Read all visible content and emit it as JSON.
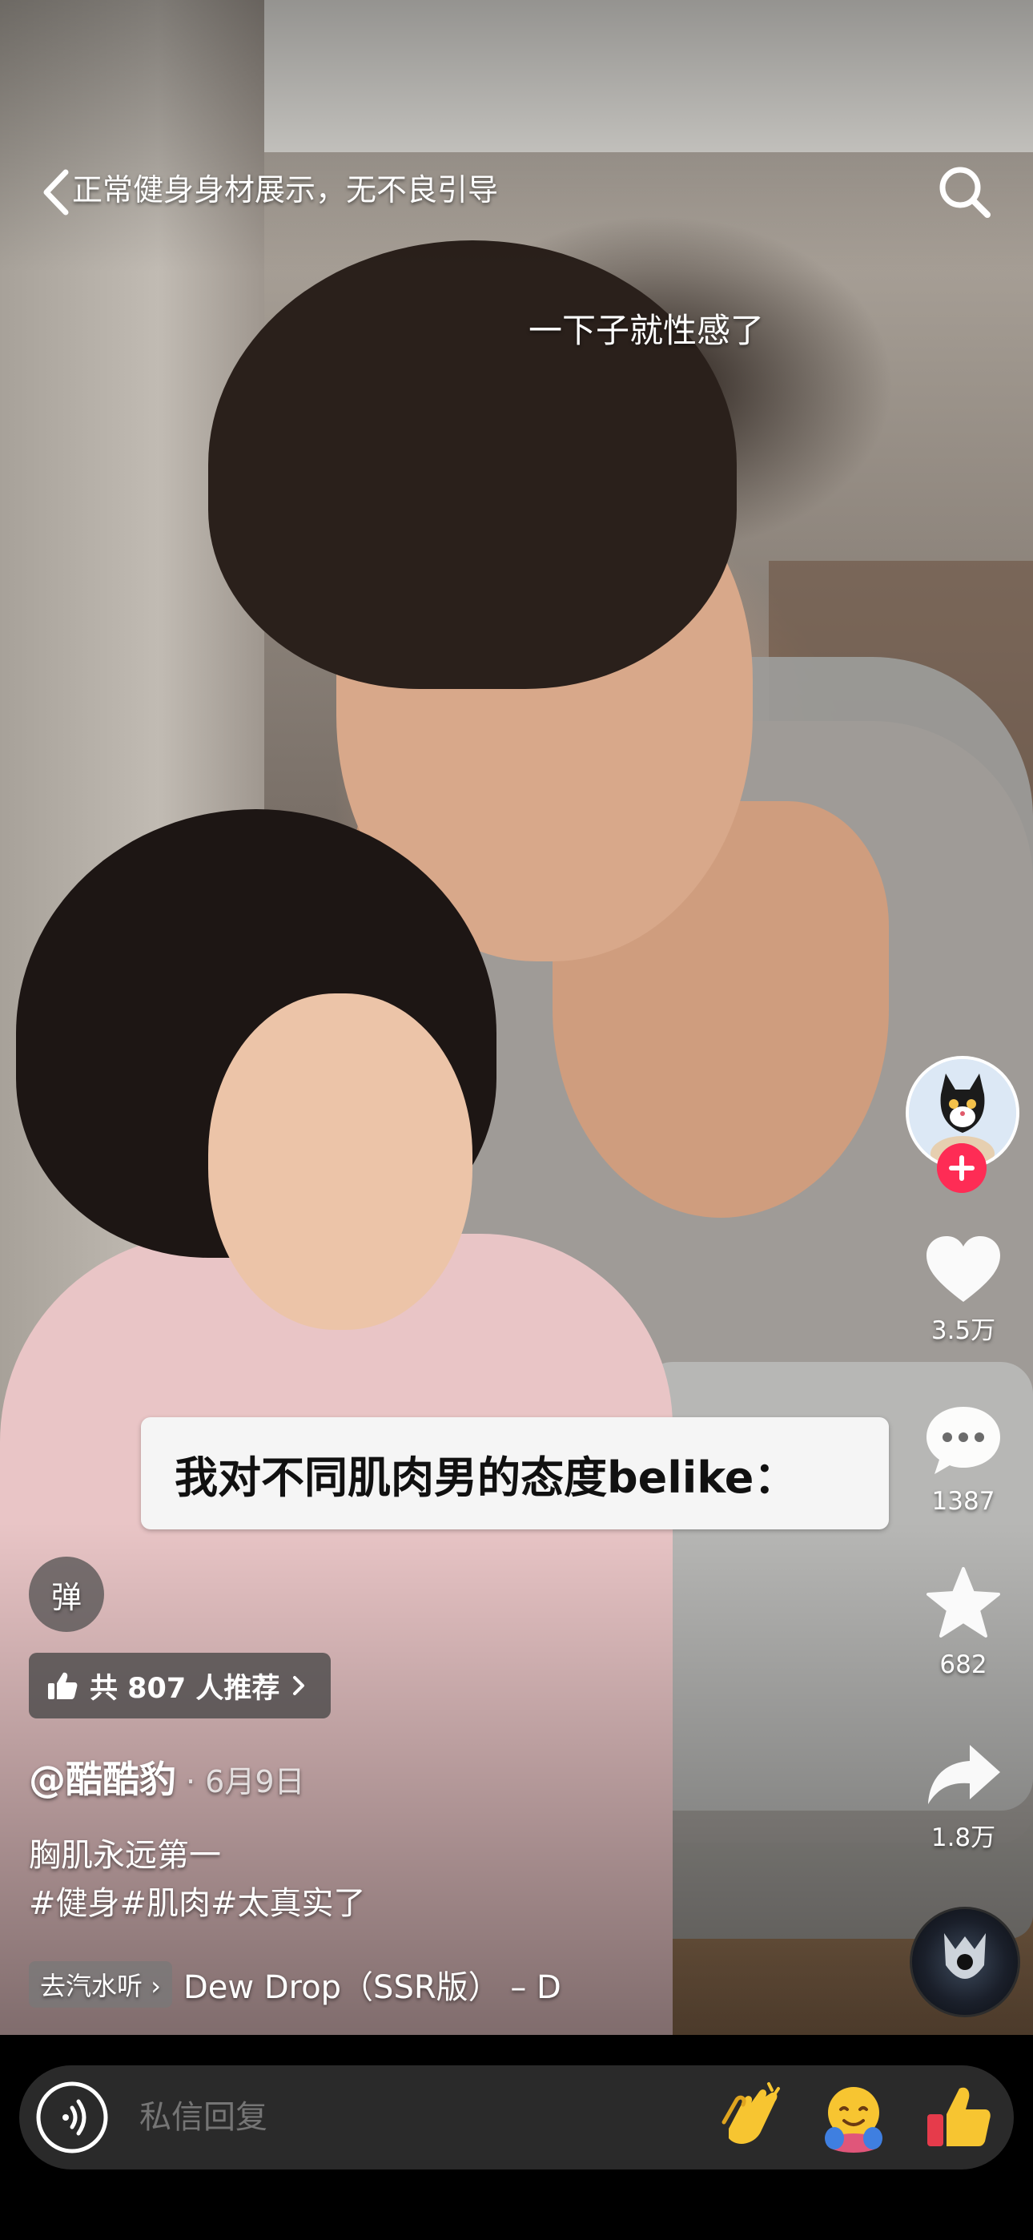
{
  "header": {
    "title": "正常健身身材展示，无不良引导",
    "back_icon": "chevron-left-icon",
    "search_icon": "search-icon"
  },
  "video": {
    "subtitle": "一下子就性感了",
    "caption": "我对不同肌肉男的态度belike："
  },
  "actions": {
    "likes": "3.5万",
    "comments": "1387",
    "favorites": "682",
    "shares": "1.8万"
  },
  "post": {
    "danmu_label": "弹",
    "recommend_label": "共 807 人推荐",
    "author": "@酷酷豹",
    "date": "· 6月9日",
    "description": "胸肌永远第一",
    "tags": [
      "#健身",
      "#肌肉",
      "#太真实了"
    ],
    "music_pill": "去汽水听",
    "music_title": "Dew Drop（SSR版） – D"
  },
  "reply_bar": {
    "placeholder": "私信回复",
    "emojis": [
      "clap-emoji",
      "hug-emoji",
      "thumbs-up-emoji"
    ]
  },
  "colors": {
    "accent": "#fe2c55",
    "bar_bg": "#2a2a2a"
  }
}
